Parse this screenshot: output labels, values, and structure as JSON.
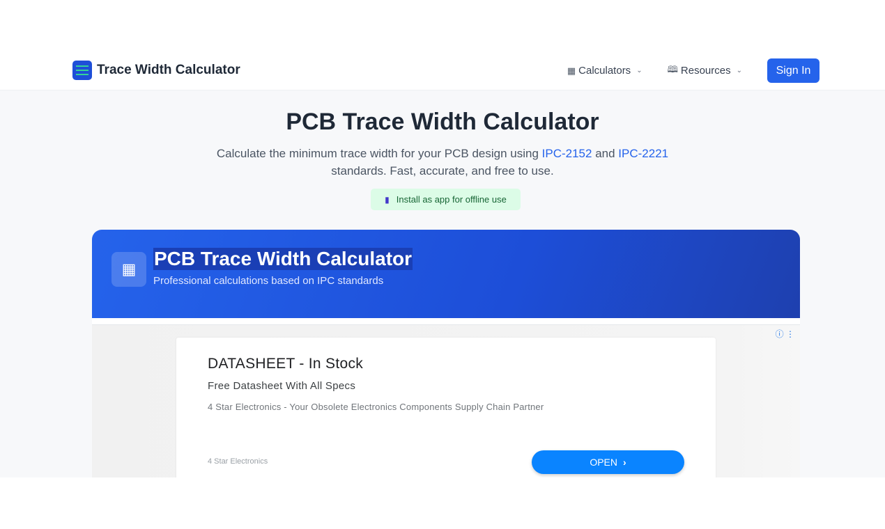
{
  "header": {
    "title": "Trace Width Calculator",
    "nav": [
      {
        "icon": "calculator-icon",
        "label": "Calculators"
      },
      {
        "icon": "book-icon",
        "label": "Resources"
      }
    ],
    "sign_in": "Sign In"
  },
  "hero": {
    "title": "PCB Trace Width Calculator",
    "subtitle_pre": "Calculate the minimum trace width for your PCB design using ",
    "link1": "IPC-2152",
    "subtitle_and": " and ",
    "link2": "IPC-2221",
    "subtitle_post": " standards. Fast, accurate, and free to use.",
    "install": "Install as app for offline use"
  },
  "card": {
    "title": "PCB Trace Width Calculator",
    "subtitle": "Professional calculations based on IPC standards"
  },
  "ad": {
    "headline": "DATASHEET - In Stock",
    "desc1": "Free Datasheet With All Specs",
    "desc2": "4 Star Electronics - Your Obsolete Electronics Components Supply Chain Partner",
    "advertiser": "4 Star Electronics",
    "cta": "OPEN"
  },
  "colors": {
    "primary": "#2563eb",
    "accent_green": "#34d399",
    "install_bg": "#dcfce7",
    "ad_button": "#0a84ff"
  }
}
